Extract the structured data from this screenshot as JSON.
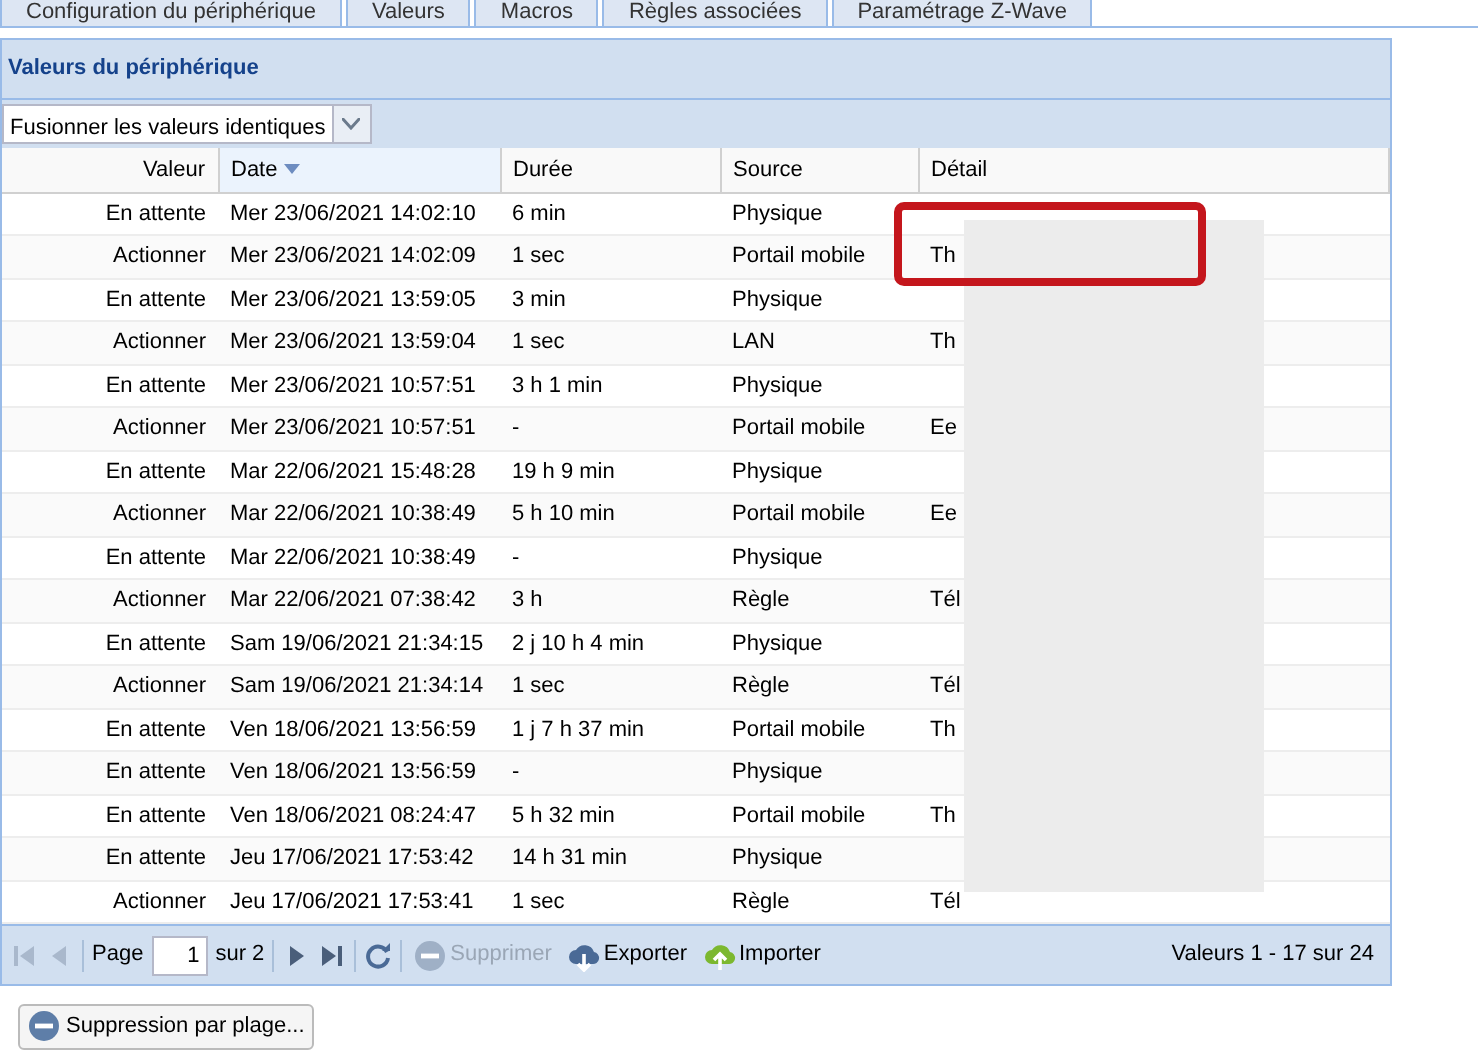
{
  "tabs": [
    {
      "label": "Configuration du périphérique"
    },
    {
      "label": "Valeurs"
    },
    {
      "label": "Macros"
    },
    {
      "label": "Règles associées"
    },
    {
      "label": "Paramétrage Z-Wave"
    }
  ],
  "panel": {
    "title": "Valeurs du périphérique",
    "merge_select": {
      "value": "Fusionner les valeurs identiques"
    }
  },
  "table": {
    "columns": [
      {
        "label": "Valeur",
        "sorted": false
      },
      {
        "label": "Date",
        "sorted": true
      },
      {
        "label": "Durée",
        "sorted": false
      },
      {
        "label": "Source",
        "sorted": false
      },
      {
        "label": "Détail",
        "sorted": false
      }
    ],
    "rows": [
      [
        "En attente",
        "Mer 23/06/2021 14:02:10",
        "6 min",
        "Physique",
        ""
      ],
      [
        "Actionner",
        "Mer 23/06/2021 14:02:09",
        "1 sec",
        "Portail mobile",
        "Th"
      ],
      [
        "En attente",
        "Mer 23/06/2021 13:59:05",
        "3 min",
        "Physique",
        ""
      ],
      [
        "Actionner",
        "Mer 23/06/2021 13:59:04",
        "1 sec",
        "LAN",
        "Th"
      ],
      [
        "En attente",
        "Mer 23/06/2021 10:57:51",
        "3 h 1 min",
        "Physique",
        ""
      ],
      [
        "Actionner",
        "Mer 23/06/2021 10:57:51",
        "-",
        "Portail mobile",
        "Ee"
      ],
      [
        "En attente",
        "Mar 22/06/2021 15:48:28",
        "19 h 9 min",
        "Physique",
        ""
      ],
      [
        "Actionner",
        "Mar 22/06/2021 10:38:49",
        "5 h 10 min",
        "Portail mobile",
        "Ee"
      ],
      [
        "En attente",
        "Mar 22/06/2021 10:38:49",
        "-",
        "Physique",
        ""
      ],
      [
        "Actionner",
        "Mar 22/06/2021 07:38:42",
        "3 h",
        "Règle",
        "Tél"
      ],
      [
        "En attente",
        "Sam 19/06/2021 21:34:15",
        "2 j 10 h 4 min",
        "Physique",
        ""
      ],
      [
        "Actionner",
        "Sam 19/06/2021 21:34:14",
        "1 sec",
        "Règle",
        "Tél"
      ],
      [
        "En attente",
        "Ven 18/06/2021 13:56:59",
        "1 j 7 h 37 min",
        "Portail mobile",
        "Th"
      ],
      [
        "En attente",
        "Ven 18/06/2021 13:56:59",
        "-",
        "Physique",
        ""
      ],
      [
        "En attente",
        "Ven 18/06/2021 08:24:47",
        "5 h 32 min",
        "Portail mobile",
        "Th"
      ],
      [
        "En attente",
        "Jeu 17/06/2021 17:53:42",
        "14 h 31 min",
        "Physique",
        ""
      ],
      [
        "Actionner",
        "Jeu 17/06/2021 17:53:41",
        "1 sec",
        "Règle",
        "Tél"
      ]
    ]
  },
  "pager": {
    "page_label": "Page",
    "page": "1",
    "of_label": "sur 2",
    "delete": {
      "label": "Supprimer",
      "disabled": true
    },
    "export": {
      "label": "Exporter"
    },
    "import": {
      "label": "Importer"
    },
    "summary": "Valeurs 1 - 17 sur 24"
  },
  "range_delete_button": "Suppression par plage..."
}
